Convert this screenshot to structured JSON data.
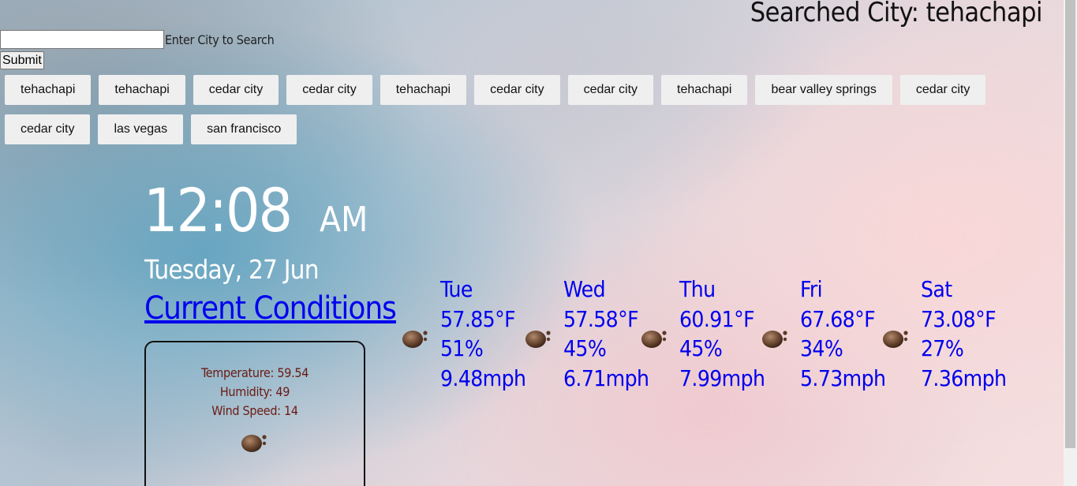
{
  "header": {
    "searched_city": "Searched City: tehachapi"
  },
  "search": {
    "value": "",
    "label": "Enter City to Search",
    "submit_label": "Submit"
  },
  "history": [
    [
      "tehachapi",
      "tehachapi",
      "cedar city",
      "cedar city",
      "tehachapi",
      "cedar city",
      "cedar city",
      "tehachapi",
      "bear valley springs",
      "cedar city"
    ],
    [
      "cedar city",
      "las vegas",
      "san francisco"
    ]
  ],
  "clock": {
    "time": "12:08",
    "ampm": "AM",
    "date": "Tuesday, 27 Jun"
  },
  "current": {
    "link_label": "Current Conditions",
    "temperature": "Temperature: 59.54",
    "humidity": "Humidity: 49",
    "wind": "Wind Speed: 14",
    "icon": "weather-icon"
  },
  "forecast": [
    {
      "day": "Tue",
      "temp": "57.85°F",
      "humidity": "51%",
      "wind": "9.48mph",
      "icon": "weather-icon"
    },
    {
      "day": "Wed",
      "temp": "57.58°F",
      "humidity": "45%",
      "wind": "6.71mph",
      "icon": "weather-icon"
    },
    {
      "day": "Thu",
      "temp": "60.91°F",
      "humidity": "45%",
      "wind": "7.99mph",
      "icon": "weather-icon"
    },
    {
      "day": "Fri",
      "temp": "67.68°F",
      "humidity": "34%",
      "wind": "5.73mph",
      "icon": "weather-icon"
    },
    {
      "day": "Sat",
      "temp": "73.08°F",
      "humidity": "27%",
      "wind": "7.36mph",
      "icon": "weather-icon"
    }
  ],
  "colors": {
    "link": "#0000ee",
    "clock_text": "#ffffff",
    "conditions_text": "#6b1a12",
    "button_bg": "#efefef"
  }
}
